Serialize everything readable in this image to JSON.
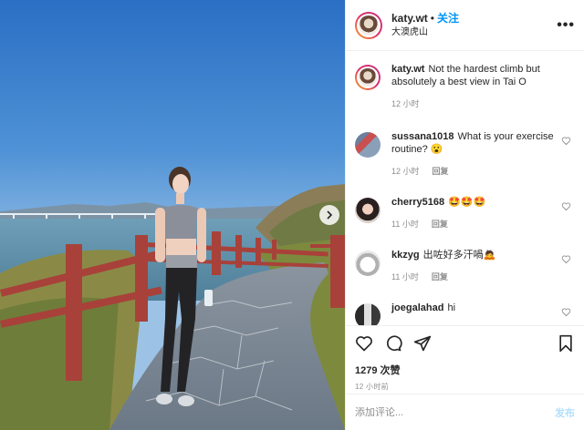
{
  "post": {
    "username": "katy.wt",
    "follow_label": "关注",
    "location": "大澳虎山",
    "more_label": "•••",
    "caption": "Not the hardest climb but absolutely a best view in Tai O",
    "caption_time": "12 小时",
    "likes": "1279 次赞",
    "time_ago": "12 小时前"
  },
  "comments": [
    {
      "user": "sussana1018",
      "text": "What is your exercise routine? 😮",
      "time": "12 小时",
      "reply": "回复"
    },
    {
      "user": "cherry5168",
      "text": "🤩🤩🤩",
      "time": "11 小时",
      "reply": "回复"
    },
    {
      "user": "kkzyg",
      "text": "出咗好多汗喎🙇",
      "time": "11 小时",
      "reply": "回复"
    },
    {
      "user": "joegalahad",
      "text": "hi",
      "time": "",
      "reply": ""
    }
  ],
  "comment_box": {
    "placeholder": "添加评论...",
    "post_label": "发布"
  },
  "colors": {
    "link": "#0095f6",
    "muted": "#8e8e8e",
    "post_disabled": "#b2dffc"
  },
  "icons": [
    "heart-icon",
    "comment-icon",
    "share-icon",
    "bookmark-icon",
    "chevron-right-icon",
    "like-comment-heart-icon"
  ]
}
